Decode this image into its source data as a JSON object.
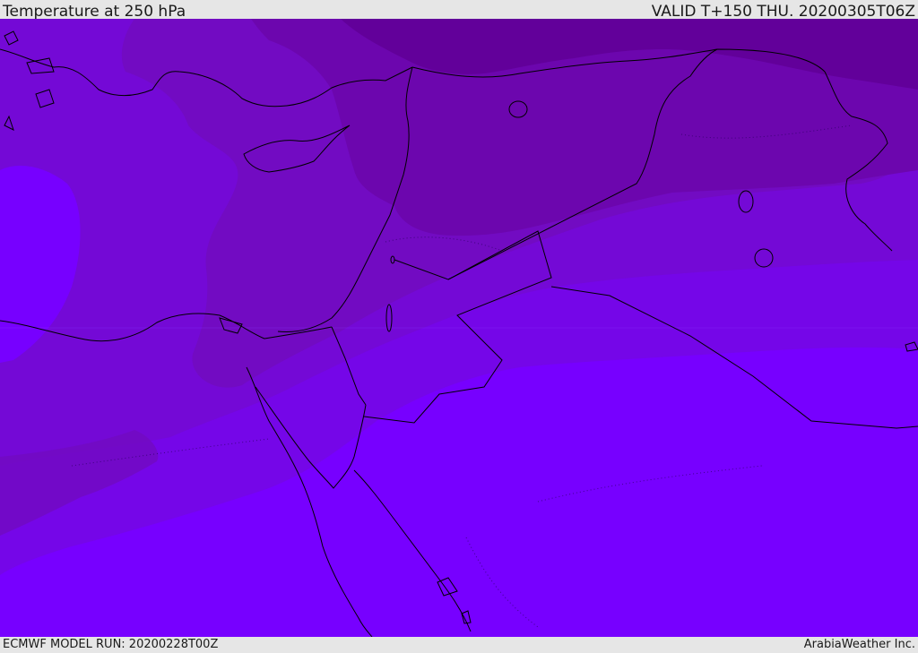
{
  "header": {
    "title": "Temperature at 250 hPa",
    "valid_time": "VALID T+150 THU. 20200305T06Z"
  },
  "footer": {
    "model_run": "ECMWF MODEL RUN: 20200228T00Z",
    "credit": "ArabiaWeather Inc."
  },
  "map": {
    "field": "temperature-250hPa",
    "colors": {
      "zone_1_lightest": "#7700ff",
      "zone_2": "#7506e8",
      "zone_3": "#7409d6",
      "zone_4": "#720bc2",
      "zone_5": "#6c06ae",
      "zone_6_darkest": "#62009a",
      "boundary": "#000000"
    }
  }
}
